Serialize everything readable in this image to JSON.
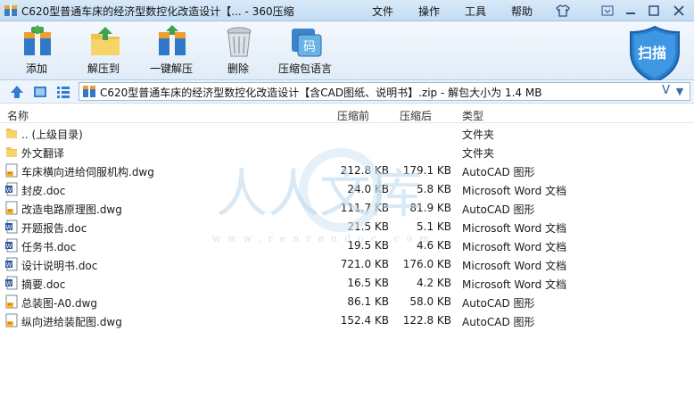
{
  "window": {
    "title": "C620型普通车床的经济型数控化改造设计【... - 360压缩",
    "menus": [
      "文件",
      "操作",
      "工具",
      "帮助"
    ]
  },
  "toolbar": {
    "buttons": [
      "添加",
      "解压到",
      "一键解压",
      "删除",
      "压缩包语言"
    ],
    "scan_label": "扫描"
  },
  "address": {
    "path": "C620型普通车床的经济型数控化改造设计【含CAD图纸、说明书】.zip - 解包大小为 1.4 MB",
    "v_mark": "V"
  },
  "columns": [
    "名称",
    "压缩前",
    "压缩后",
    "类型"
  ],
  "files": [
    {
      "name": ".. (上级目录)",
      "before": "",
      "after": "",
      "type": "文件夹",
      "icon": "folder-icon"
    },
    {
      "name": "外文翻译",
      "before": "",
      "after": "",
      "type": "文件夹",
      "icon": "folder-icon"
    },
    {
      "name": "车床横向进给伺服机构.dwg",
      "before": "212.8 KB",
      "after": "179.1 KB",
      "type": "AutoCAD 图形",
      "icon": "dwg-icon"
    },
    {
      "name": "封皮.doc",
      "before": "24.0 KB",
      "after": "5.8 KB",
      "type": "Microsoft Word 文档",
      "icon": "doc-icon"
    },
    {
      "name": "改造电路原理图.dwg",
      "before": "111.7 KB",
      "after": "81.9 KB",
      "type": "AutoCAD 图形",
      "icon": "dwg-icon"
    },
    {
      "name": "开题报告.doc",
      "before": "21.5 KB",
      "after": "5.1 KB",
      "type": "Microsoft Word 文档",
      "icon": "doc-icon"
    },
    {
      "name": "任务书.doc",
      "before": "19.5 KB",
      "after": "4.6 KB",
      "type": "Microsoft Word 文档",
      "icon": "doc-icon"
    },
    {
      "name": "设计说明书.doc",
      "before": "721.0 KB",
      "after": "176.0 KB",
      "type": "Microsoft Word 文档",
      "icon": "doc-icon"
    },
    {
      "name": "摘要.doc",
      "before": "16.5 KB",
      "after": "4.2 KB",
      "type": "Microsoft Word 文档",
      "icon": "doc-icon"
    },
    {
      "name": "总装图-A0.dwg",
      "before": "86.1 KB",
      "after": "58.0 KB",
      "type": "AutoCAD 图形",
      "icon": "dwg-icon"
    },
    {
      "name": "纵向进给装配图.dwg",
      "before": "152.4 KB",
      "after": "122.8 KB",
      "type": "AutoCAD 图形",
      "icon": "dwg-icon"
    }
  ],
  "watermark": {
    "text": "人人文库",
    "url": "www.renrendoc.com"
  }
}
